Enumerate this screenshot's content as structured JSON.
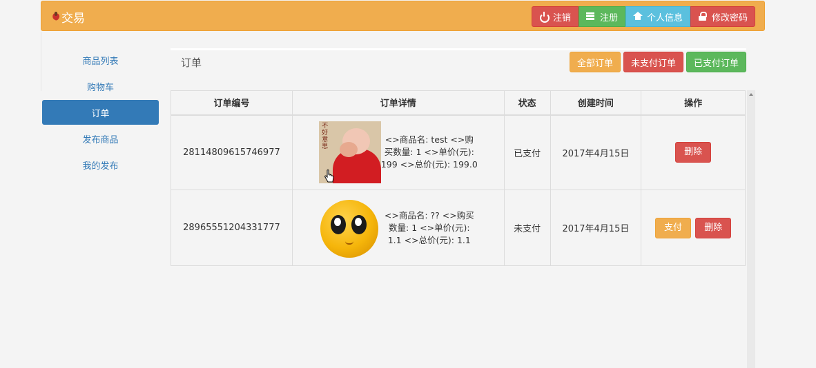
{
  "brand": {
    "title": "交易"
  },
  "navbar": {
    "buttons": [
      {
        "label": "注销",
        "icon": "power-icon"
      },
      {
        "label": "注册",
        "icon": "server-icon"
      },
      {
        "label": "个人信息",
        "icon": "home-icon"
      },
      {
        "label": "修改密码",
        "icon": "lock-icon"
      }
    ]
  },
  "sidebar": {
    "items": [
      {
        "label": "商品列表"
      },
      {
        "label": "购物车"
      },
      {
        "label": "订单",
        "active": true
      },
      {
        "label": "发布商品"
      },
      {
        "label": "我的发布"
      }
    ]
  },
  "main": {
    "title": "订单",
    "filters": [
      {
        "label": "全部订单"
      },
      {
        "label": "未支付订单"
      },
      {
        "label": "已支付订单"
      }
    ]
  },
  "table": {
    "headers": [
      "订单编号",
      "订单详情",
      "状态",
      "创建时间",
      "操作"
    ],
    "rows": [
      {
        "id": "28114809615746977",
        "detail": "<>商品名: test <>购买数量: 1 <>单价(元): 199 <>总价(元): 199.0",
        "image_caption": "不好意思",
        "status": "已支付",
        "created": "2017年4月15日",
        "actions": [
          "删除"
        ]
      },
      {
        "id": "28965551204331777",
        "detail": "<>商品名: ?? <>购买数量: 1 <>单价(元): 1.1 <>总价(元): 1.1",
        "status": "未支付",
        "created": "2017年4月15日",
        "actions": [
          "支付",
          "删除"
        ]
      }
    ]
  },
  "colors": {
    "navbar": "#f0ad4e",
    "primary": "#337ab7",
    "danger": "#d9534f",
    "success": "#5cb85c",
    "info": "#5bc0de",
    "warning": "#f0ad4e"
  }
}
